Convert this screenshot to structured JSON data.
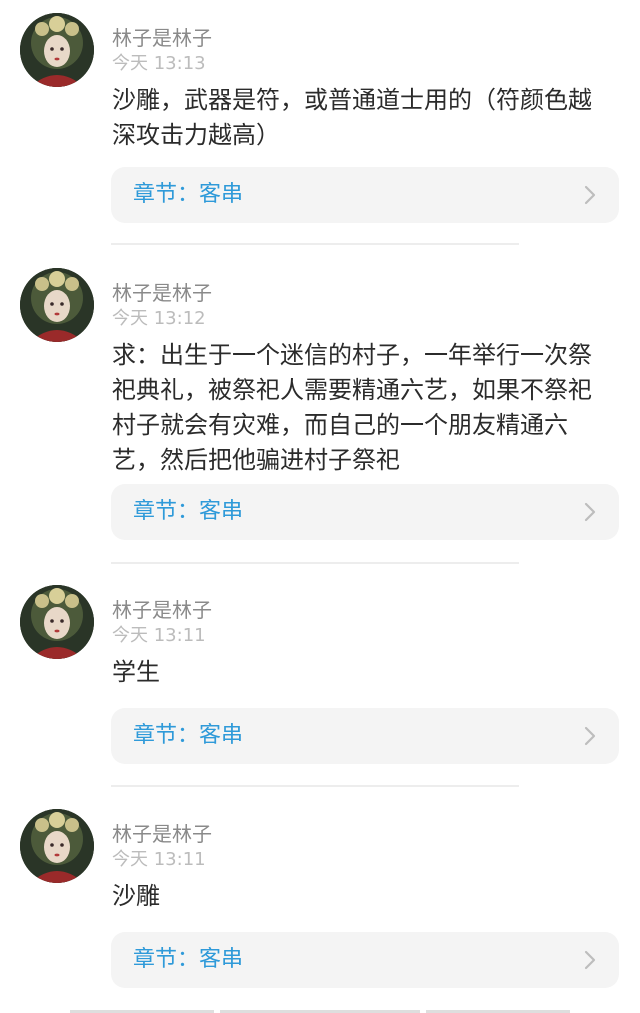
{
  "posts": [
    {
      "username": "林子是林子",
      "time": "今天 13:13",
      "content": "沙雕，武器是符，或普通道士用的（符颜色越深攻击力越高）",
      "chapter": "章节：客串"
    },
    {
      "username": "林子是林子",
      "time": "今天 13:12",
      "content": "求：出生于一个迷信的村子，一年举行一次祭祀典礼，被祭祀人需要精通六艺，如果不祭祀村子就会有灾难，而自己的一个朋友精通六艺，然后把他骗进村子祭祀",
      "chapter": "章节：客串"
    },
    {
      "username": "林子是林子",
      "time": "今天 13:11",
      "content": "学生",
      "chapter": "章节：客串"
    },
    {
      "username": "林子是林子",
      "time": "今天 13:11",
      "content": "沙雕",
      "chapter": "章节：客串"
    }
  ],
  "icons": {
    "avatar": "avatar-portrait-icon",
    "chapter_arrow": "chevron-right-icon"
  },
  "colors": {
    "username": "#8a8a8a",
    "time": "#bcbcbc",
    "content": "#2b2b2b",
    "chapter_text": "#2f9ad9",
    "chapter_bg": "#f4f4f4"
  }
}
